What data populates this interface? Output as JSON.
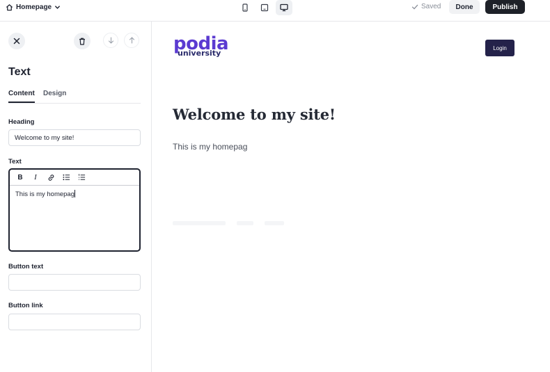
{
  "topbar": {
    "page_name": "Homepage",
    "device_icons": [
      "mobile-icon",
      "tablet-icon",
      "desktop-icon"
    ],
    "saved_label": "Saved",
    "done_label": "Done",
    "publish_label": "Publish"
  },
  "panel": {
    "title": "Text",
    "tabs": [
      "Content",
      "Design"
    ],
    "heading_label": "Heading",
    "heading_value": "Welcome to my site!",
    "text_label": "Text",
    "text_toolbar": {
      "bold": "B",
      "italic": "I"
    },
    "text_value": "This is my homepag",
    "button_text_label": "Button text",
    "button_text_value": "",
    "button_link_label": "Button link",
    "button_link_value": ""
  },
  "preview": {
    "logo_main": "podia",
    "logo_sub": "university",
    "login_label": "Login",
    "hero_title": "Welcome to my site!",
    "hero_text": "This is my homepag"
  },
  "colors": {
    "accent_dark": "#1e2128",
    "logo_purple": "#5b3bd1",
    "login_bg": "#24224a"
  }
}
